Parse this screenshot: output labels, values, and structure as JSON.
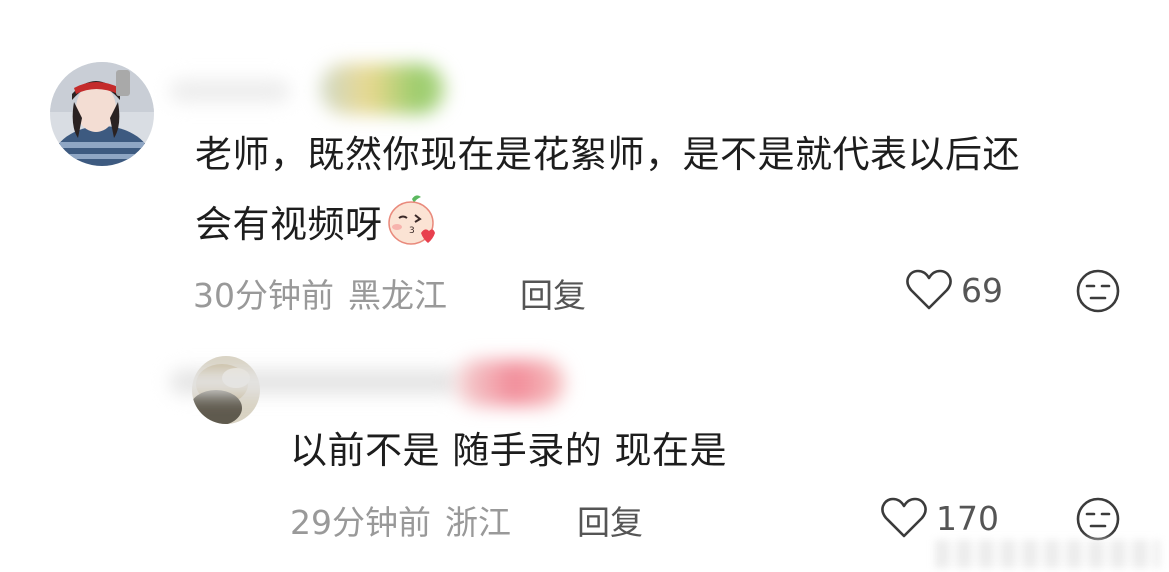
{
  "comments": [
    {
      "text_line1": "老师，既然你现在是花絮师，是不是就代表以后还",
      "text_line2": "会有视频呀",
      "time": "30分钟前",
      "location": "黑龙江",
      "reply_label": "回复",
      "likes": "69",
      "emoji_icon": "kiss-face-emoji",
      "like_icon": "heart-outline-icon",
      "face_icon": "neutral-face-icon"
    },
    {
      "text": "以前不是 随手录的 现在是",
      "time": "29分钟前",
      "location": "浙江",
      "reply_label": "回复",
      "likes": "170",
      "like_icon": "heart-outline-icon",
      "face_icon": "neutral-face-icon"
    }
  ],
  "colors": {
    "text": "#1d1d1d",
    "meta": "#999999",
    "action": "#555555"
  }
}
